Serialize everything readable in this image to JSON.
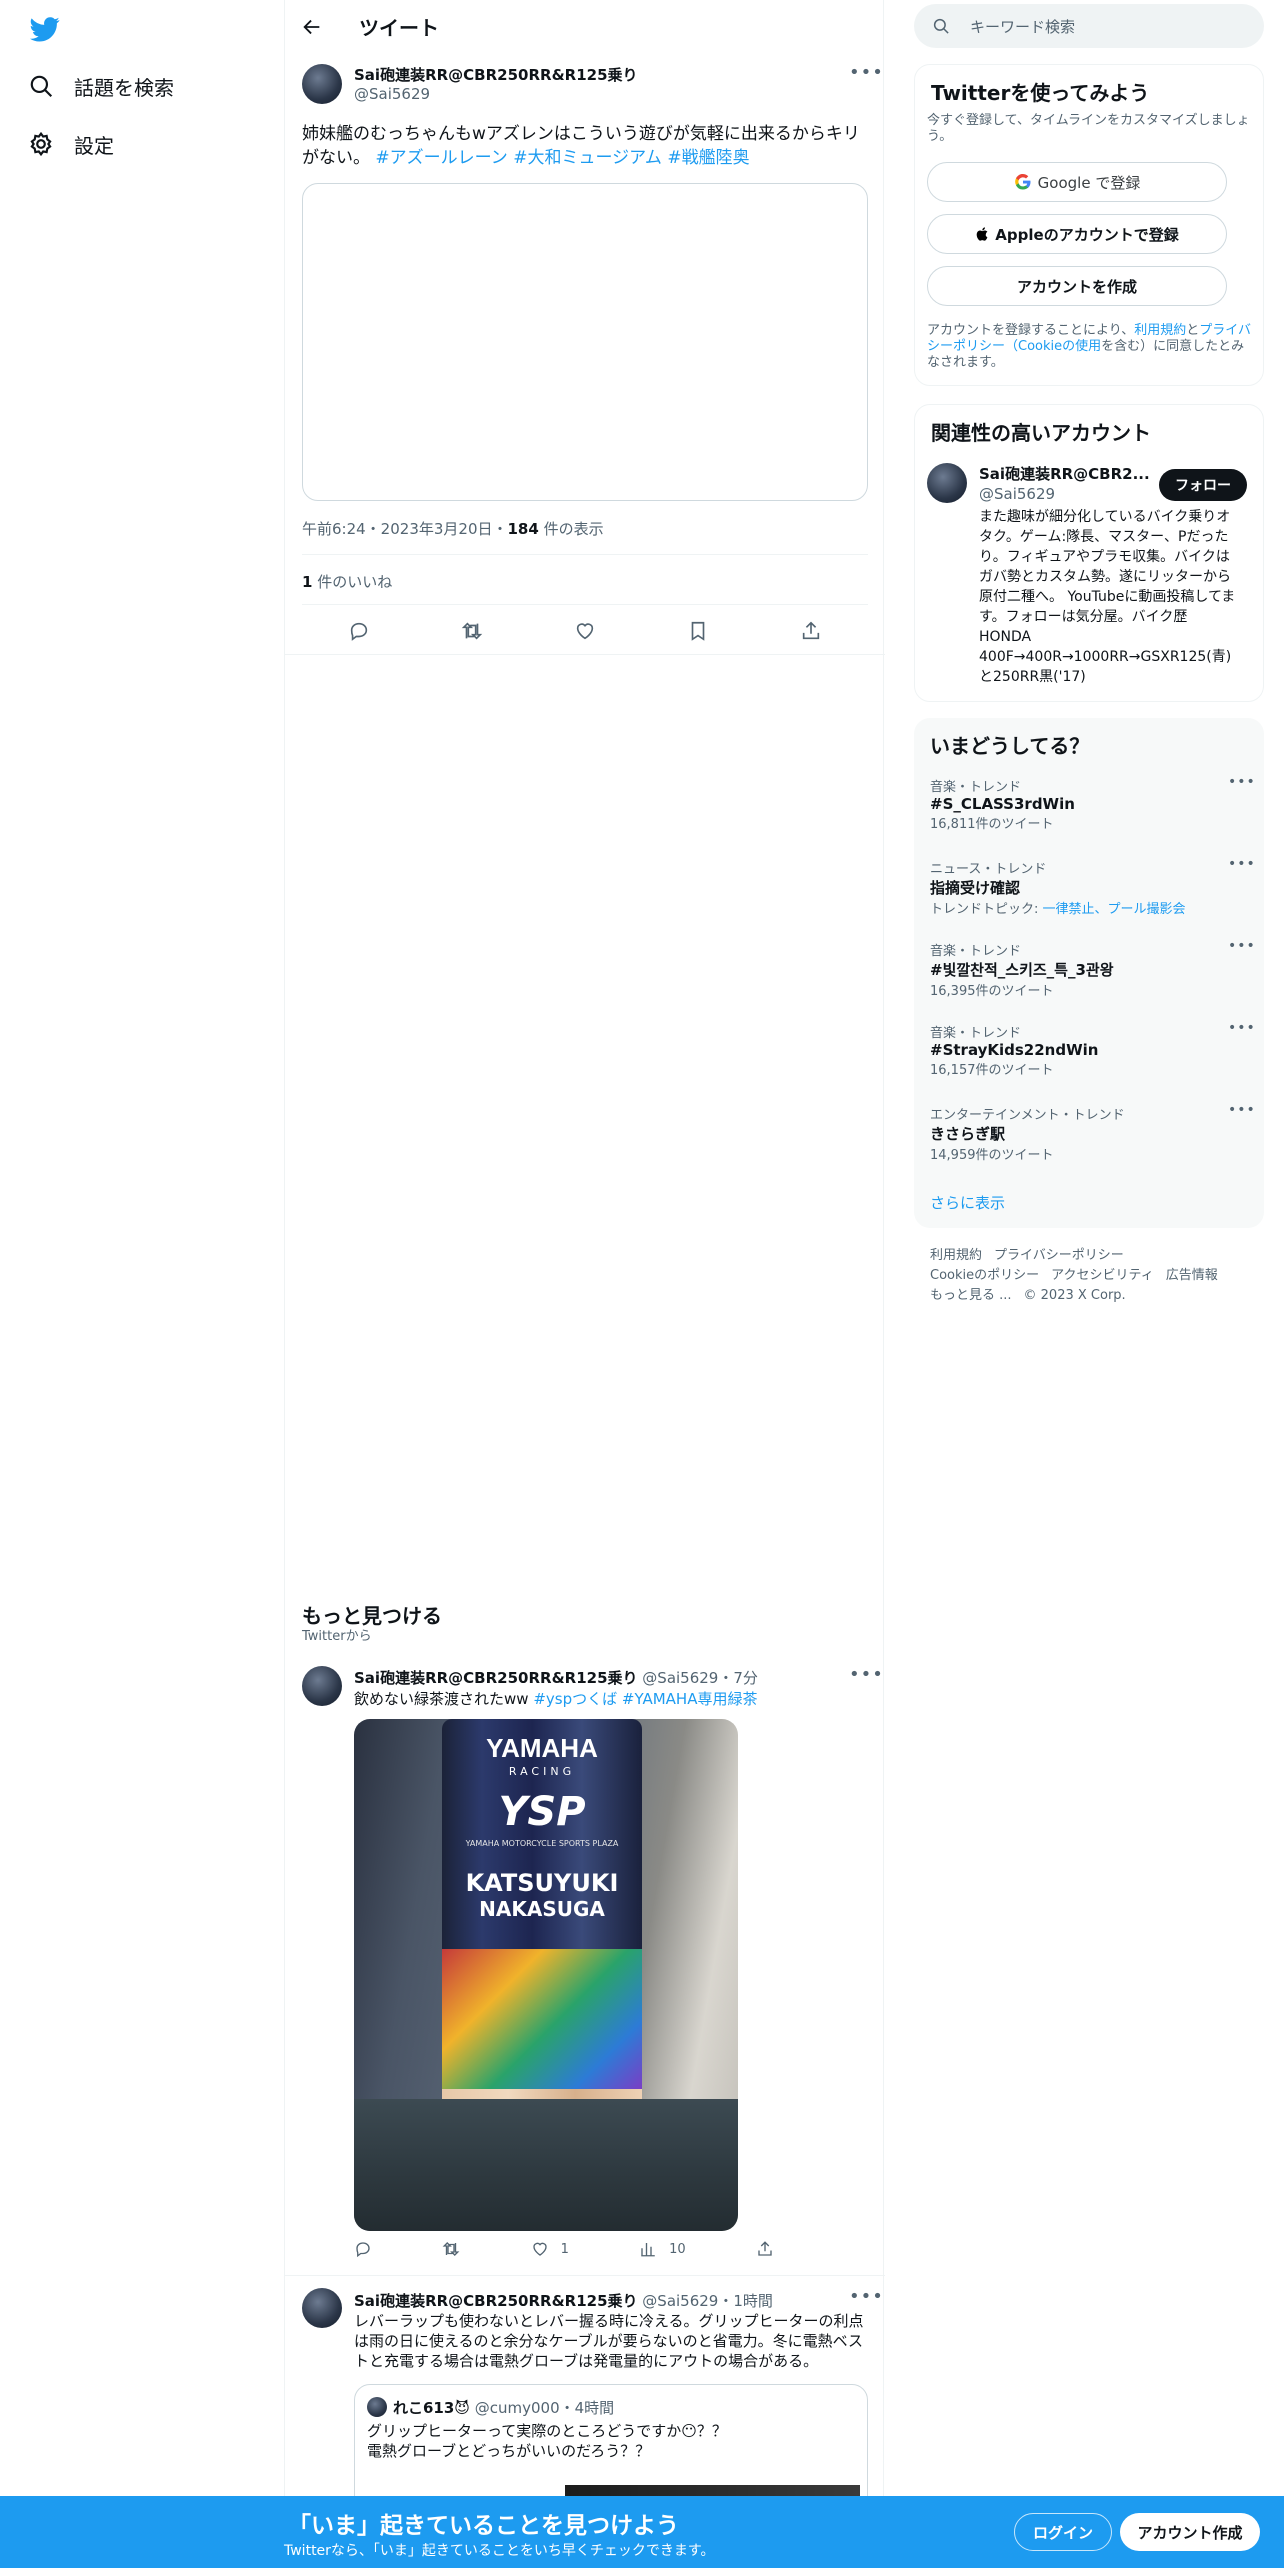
{
  "nav": {
    "items": [
      {
        "label": "話題を検索",
        "icon": "search-icon"
      },
      {
        "label": "設定",
        "icon": "gear-icon"
      }
    ]
  },
  "header": {
    "title": "ツイート"
  },
  "tweet": {
    "name": "Sai砲連装RR@CBR250RR&R125乗り",
    "handle": "@Sai5629",
    "text": "姉妹艦のむっちゃんもwアズレンはこういう遊びが気軽に出来るからキリがない。",
    "hashtags": [
      "#アズールレーン",
      "#大和ミュージアム",
      "#戦艦陸奥"
    ],
    "time": "午前6:24・2023年3月20日・",
    "views_count": "184",
    "views_label": " 件の表示",
    "likes_count": "1",
    "likes_label": " 件のいいね"
  },
  "more": {
    "title": "もっと見つける",
    "subtitle": "Twitterから"
  },
  "feed": [
    {
      "name": "Sai砲連装RR@CBR250RR&R125乗り",
      "handle": "@Sai5629",
      "age": "・7分",
      "text": "飲めない緑茶渡されたww ",
      "hashtags": [
        "#yspつくば",
        "#YAMAHA専用緑茶"
      ],
      "likes": "1",
      "views": "10",
      "can_brand": "YAMAHA",
      "can_sub": "RACING",
      "can_logo": "YSP",
      "can_small": "YAMAHA MOTORCYCLE SPORTS PLAZA",
      "can_rider1": "KATSUYUKI",
      "can_rider2": "NAKASUGA"
    },
    {
      "name": "Sai砲連装RR@CBR250RR&R125乗り",
      "handle": "@Sai5629",
      "age": "・1時間",
      "text": "レバーラップも使わないとレバー握る時に冷える。グリップヒーターの利点は雨の日に使えるのと余分なケーブルが要らないのと省電力。冬に電熱ベストと充電する場合は電熱グローブは発電量的にアウトの場合がある。",
      "quote": {
        "name": "れこ613😈",
        "handle": "@cumy000",
        "age": "・4時間",
        "line1": "グリップヒーターって実際のところどうですか😶？？",
        "line2": "電熱グローブとどっちがいいのだろう？？"
      }
    }
  ],
  "sidebar": {
    "search_placeholder": "キーワード検索",
    "signup": {
      "title": "Twitterを使ってみよう",
      "subtitle": "今すぐ登録して、タイムラインをカスタマイズしましょう。",
      "google": "Google で登録",
      "apple": "Appleのアカウントで登録",
      "create": "アカウントを作成",
      "legal_1": "アカウントを登録することにより、",
      "legal_terms": "利用規約",
      "legal_2": "と",
      "legal_privacy": "プライバシーポリシー（Cookieの使用",
      "legal_3": "を含む）に同意したとみなされます。"
    },
    "relevant": {
      "title": "関連性の高いアカウント",
      "name": "Sai砲連装RR@CBR2...",
      "handle": "@Sai5629",
      "follow": "フォロー",
      "bio": "また趣味が細分化しているバイク乗りオタク。ゲーム:隊長、マスター、Pだったり。フィギュアやプラモ収集。バイクはガバ勢とカスタム勢。遂にリッターから原付二種へ。 YouTubeに動画投稿してます。フォローは気分屋。バイク歴HONDA 400F→400R→1000RR→GSXR125(青)と250RR黒('17)"
    },
    "trends": {
      "title": "いまどうしてる？",
      "items": [
        {
          "category": "音楽・トレンド",
          "name": "#S_CLASS3rdWin",
          "count": "16,811件のツイート"
        },
        {
          "category": "ニュース・トレンド",
          "name": "指摘受け確認",
          "topic_label": "トレンドトピック: ",
          "topic_links": "一律禁止、プール撮影会"
        },
        {
          "category": "音楽・トレンド",
          "name": "#빛깔찬적_스키즈_특_3관왕",
          "count": "16,395件のツイート"
        },
        {
          "category": "音楽・トレンド",
          "name": "#StrayKids22ndWin",
          "count": "16,157件のツイート"
        },
        {
          "category": "エンターテインメント・トレンド",
          "name": "きさらぎ駅",
          "count": "14,959件のツイート"
        }
      ],
      "show_more": "さらに表示"
    },
    "footer": {
      "links": [
        "利用規約",
        "プライバシーポリシー",
        "Cookieのポリシー",
        "アクセシビリティ",
        "広告情報",
        "もっと見る ..."
      ],
      "copyright": "© 2023 X Corp."
    }
  },
  "banner": {
    "title": "「いま」起きていることを見つけよう",
    "subtitle": "Twitterなら、「いま」起きていることをいち早くチェックできます。",
    "login": "ログイン",
    "signup": "アカウント作成"
  },
  "colors": {
    "accent": "#1d9bf0",
    "text": "#0f1419",
    "muted": "#536471",
    "border": "#eff3f4"
  }
}
